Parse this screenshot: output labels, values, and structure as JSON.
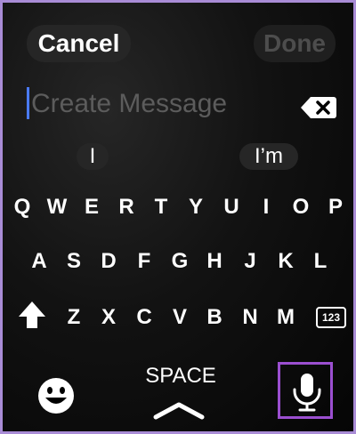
{
  "header": {
    "cancel_label": "Cancel",
    "done_label": "Done"
  },
  "input": {
    "placeholder": "Create Message"
  },
  "suggestions": [
    "I",
    "I’m"
  ],
  "keyboard": {
    "row1": [
      "Q",
      "W",
      "E",
      "R",
      "T",
      "Y",
      "U",
      "I",
      "O",
      "P"
    ],
    "row2": [
      "A",
      "S",
      "D",
      "F",
      "G",
      "H",
      "J",
      "K",
      "L"
    ],
    "row3": [
      "Z",
      "X",
      "C",
      "V",
      "B",
      "N",
      "M"
    ],
    "numbers_label": "123",
    "space_label": "SPACE"
  },
  "icons": {
    "backspace": "backspace-icon",
    "shift": "shift-icon",
    "emoji": "emoji-icon",
    "chevron": "chevron-up-icon",
    "mic": "microphone-icon"
  },
  "colors": {
    "caret": "#4a7bff",
    "highlight": "#9b4fd0"
  }
}
